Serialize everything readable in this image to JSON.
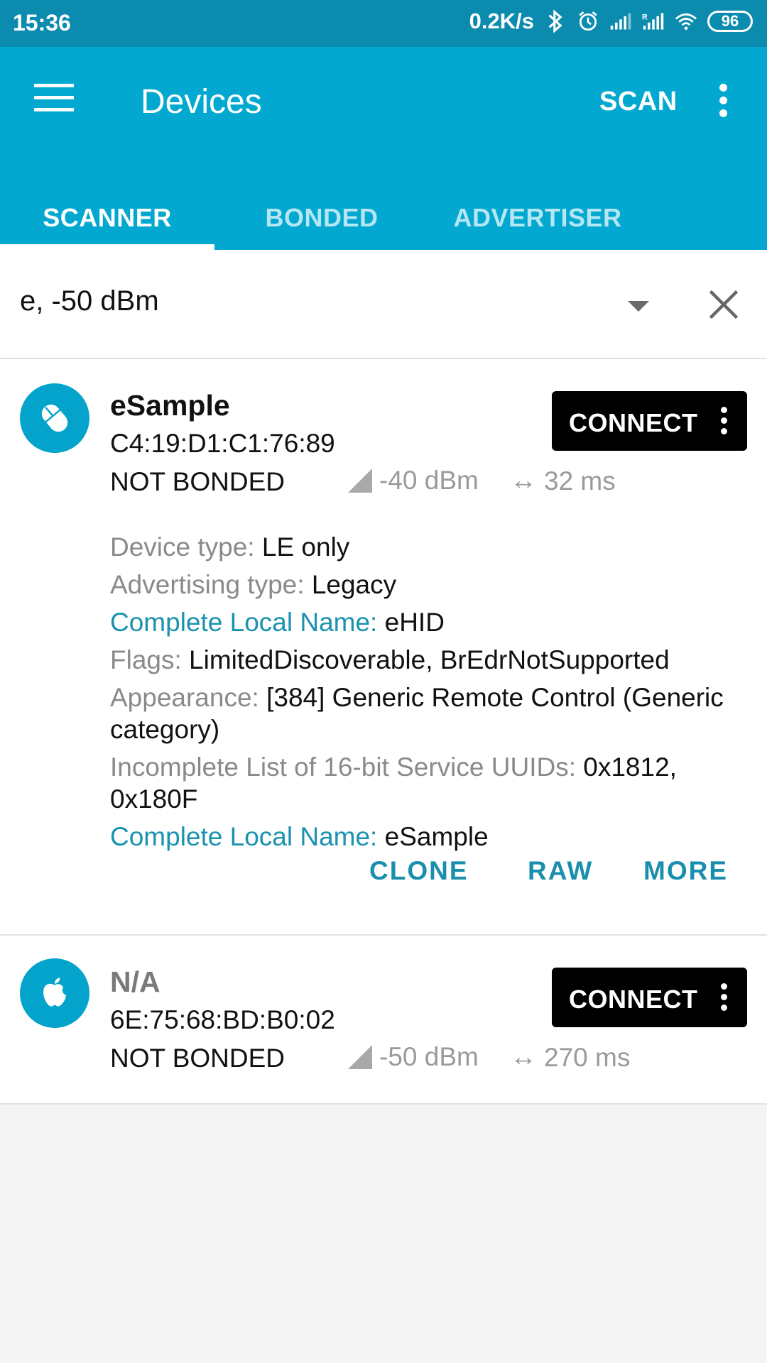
{
  "status_bar": {
    "time": "15:36",
    "network_speed": "0.2K/s",
    "battery": "96",
    "icons": [
      "bluetooth-icon",
      "alarm-icon",
      "signal-icon",
      "signal-r-icon",
      "wifi-icon",
      "battery-icon"
    ]
  },
  "app_bar": {
    "title": "Devices",
    "scan_label": "SCAN",
    "background_color": "#02a8d0"
  },
  "tabs": [
    {
      "label": "SCANNER",
      "active": true
    },
    {
      "label": "BONDED",
      "active": false
    },
    {
      "label": "ADVERTISER",
      "active": false
    }
  ],
  "filter": {
    "value": "e, -50 dBm"
  },
  "devices": [
    {
      "name": "eSample",
      "address": "C4:19:D1:C1:76:89",
      "bond_state": "NOT BONDED",
      "rssi": "-40 dBm",
      "interval": "32 ms",
      "connect_label": "CONNECT",
      "icon": "mouse-icon",
      "details": [
        {
          "label": "Device type: ",
          "value": "LE only",
          "label_style": "grey"
        },
        {
          "label": "Advertising type: ",
          "value": "Legacy",
          "label_style": "grey"
        },
        {
          "label": "Complete Local Name: ",
          "value": "eHID",
          "label_style": "blue"
        },
        {
          "label": "Flags: ",
          "value": "LimitedDiscoverable, BrEdrNotSupported",
          "label_style": "grey"
        },
        {
          "label": "Appearance: ",
          "value": "[384] Generic Remote Control (Generic category)",
          "label_style": "grey"
        },
        {
          "label": "Incomplete List of 16-bit Service UUIDs: ",
          "value": "0x1812, 0x180F",
          "label_style": "grey"
        },
        {
          "label": "Complete Local Name: ",
          "value": "eSample",
          "label_style": "blue"
        }
      ],
      "actions": [
        "CLONE",
        "RAW",
        "MORE"
      ]
    },
    {
      "name": "N/A",
      "address": "6E:75:68:BD:B0:02",
      "bond_state": "NOT BONDED",
      "rssi": "-50 dBm",
      "interval": "270 ms",
      "connect_label": "CONNECT",
      "icon": "apple-icon"
    }
  ]
}
